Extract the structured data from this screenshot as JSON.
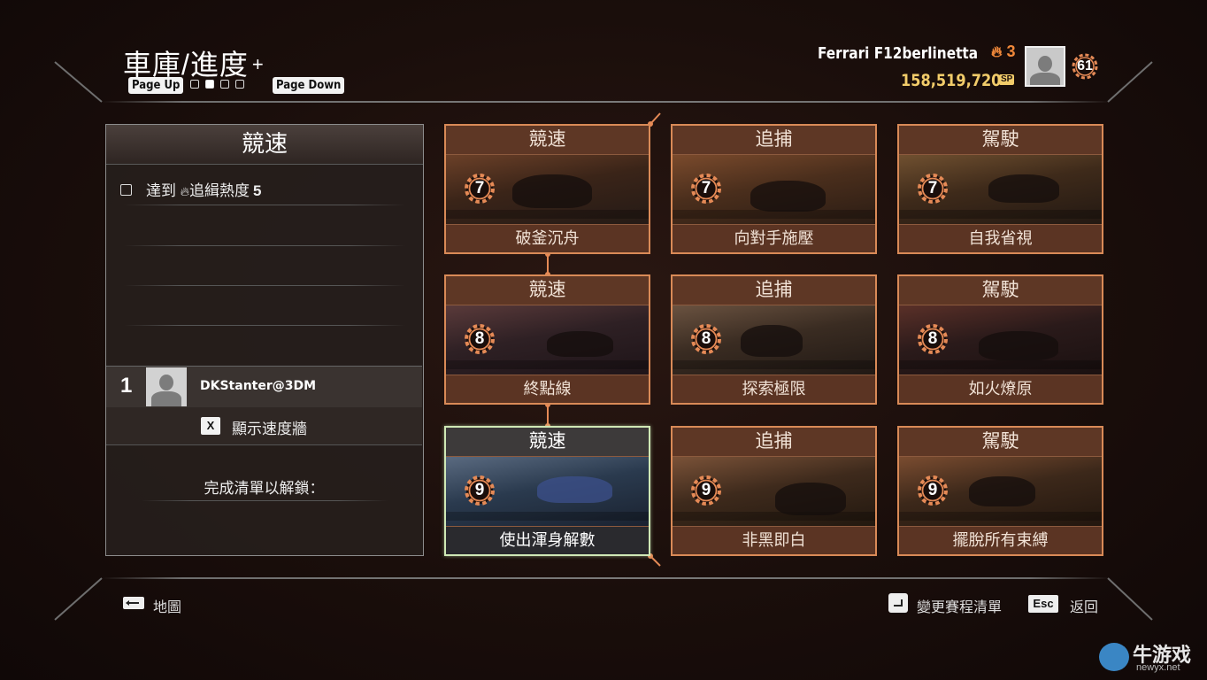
{
  "header": {
    "title": "車庫/進度",
    "title_plus": "+",
    "page_up": "Page Up",
    "page_down": "Page Down",
    "pager": {
      "count": 4,
      "active_index": 1
    },
    "car_name": "Ferrari F12berlinetta",
    "heat": "3",
    "money": "158,519,720",
    "money_unit": "SP",
    "level": "61"
  },
  "left_panel": {
    "title": "競速",
    "task": {
      "prefix": "達到",
      "label": "追緝熱度",
      "value": "5"
    },
    "leaderboard": {
      "rank": "1",
      "player": "DKStanter@3DM"
    },
    "speedwall": {
      "key": "X",
      "label": "顯示速度牆"
    },
    "unlock_text": "完成清單以解鎖："
  },
  "cards": [
    {
      "category": "競速",
      "level": "7",
      "title": "破釜沉舟",
      "selected": false
    },
    {
      "category": "追捕",
      "level": "7",
      "title": "向對手施壓",
      "selected": false
    },
    {
      "category": "駕駛",
      "level": "7",
      "title": "自我省視",
      "selected": false
    },
    {
      "category": "競速",
      "level": "8",
      "title": "終點線",
      "selected": false
    },
    {
      "category": "追捕",
      "level": "8",
      "title": "探索極限",
      "selected": false
    },
    {
      "category": "駕駛",
      "level": "8",
      "title": "如火燎原",
      "selected": false
    },
    {
      "category": "競速",
      "level": "9",
      "title": "使出渾身解數",
      "selected": true
    },
    {
      "category": "追捕",
      "level": "9",
      "title": "非黑即白",
      "selected": false
    },
    {
      "category": "駕駛",
      "level": "9",
      "title": "擺脫所有束縛",
      "selected": false
    }
  ],
  "footer": {
    "map_label": "地圖",
    "change_label": "變更賽程清單",
    "esc_key": "Esc",
    "back_label": "返回"
  },
  "watermark": {
    "name": "牛游戏",
    "url": "newyx.net"
  },
  "colors": {
    "accent": "#e58a56",
    "money": "#f2cc6a",
    "selected_border": "#cfe8b5"
  }
}
